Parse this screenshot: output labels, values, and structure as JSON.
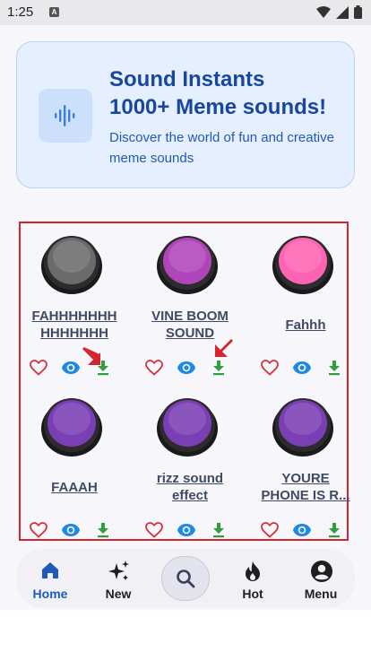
{
  "status": {
    "time": "1:25",
    "sim_icon": "A"
  },
  "banner": {
    "title_line1": "Sound Instants",
    "title_line2": "1000+ Meme sounds!",
    "subtitle": "Discover the world of fun and creative meme sounds"
  },
  "sounds": [
    {
      "label": "FAHHHHHHH\nHHHHHHH",
      "color": "#6b6b6b"
    },
    {
      "label": "VINE BOOM\nSOUND",
      "color": "#b045b9"
    },
    {
      "label": "Fahhh",
      "color": "#ff64b4"
    },
    {
      "label": "FAAAH",
      "color": "#7a3fb4"
    },
    {
      "label": "rizz sound\neffect",
      "color": "#7a3fb4"
    },
    {
      "label": "YOURE\nPHONE IS R...",
      "color": "#7a3fb4"
    }
  ],
  "nav": {
    "home": "Home",
    "new": "New",
    "hot": "Hot",
    "menu": "Menu"
  },
  "colors": {
    "accent": "#1e5bb8",
    "heart": "#d6303a",
    "eye": "#1e88e5",
    "download": "#2e9e3e",
    "highlight": "#d4242f"
  }
}
